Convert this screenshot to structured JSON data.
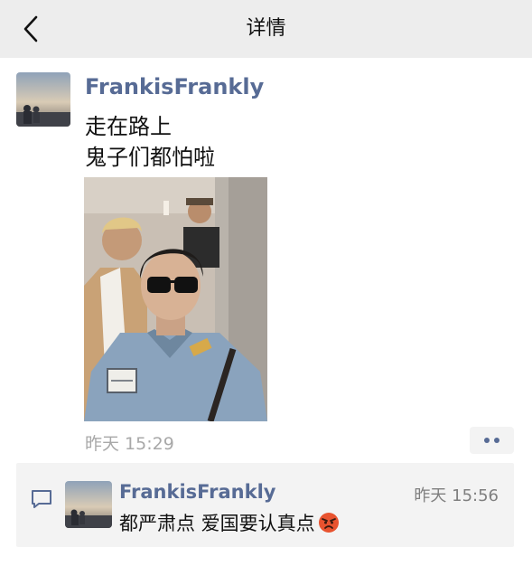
{
  "nav": {
    "title": "详情",
    "back_icon": "chevron-left-icon"
  },
  "post": {
    "author": "FrankisFrankly",
    "lines": [
      "走在路上",
      "鬼子们都怕啦"
    ],
    "time": "昨天 15:29",
    "more_icon": "more-dots-icon"
  },
  "comment": {
    "icon": "comment-bubble-icon",
    "author": "FrankisFrankly",
    "time": "昨天 15:56",
    "text": "都严肃点 爱国要认真点",
    "emoji": "angry-face-emoji"
  },
  "colors": {
    "nav_bg": "#ededed",
    "link_blue": "#576b95",
    "panel_bg": "#f3f3f3",
    "muted_text": "#a8a8a8"
  }
}
